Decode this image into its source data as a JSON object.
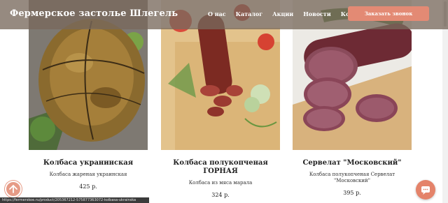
{
  "header": {
    "brand": "Фермерское застолье Шлегель",
    "nav": [
      "О нас",
      "Каталог",
      "Акции",
      "Новости",
      "Контакты"
    ],
    "cta": "Заказать звонок"
  },
  "products": [
    {
      "name": "Колбаса укранинская",
      "desc": "Колбаса жареная украинская",
      "price": "425 р."
    },
    {
      "name": "Колбаса полукопченая ГОРНАЯ",
      "desc": "Колбаса из мяса марала",
      "price": "324 р."
    },
    {
      "name": "Сервелат \"Московский\"",
      "desc": "Колбаса полукопченая Сервелат \"Московский\"",
      "price": "395 р."
    }
  ],
  "status_url": "https://fermerskoe.ru/product/205367212-575877363072-kolbasa-ukrainska",
  "colors": {
    "header_bg": "#78695c",
    "accent": "#e38a74"
  }
}
